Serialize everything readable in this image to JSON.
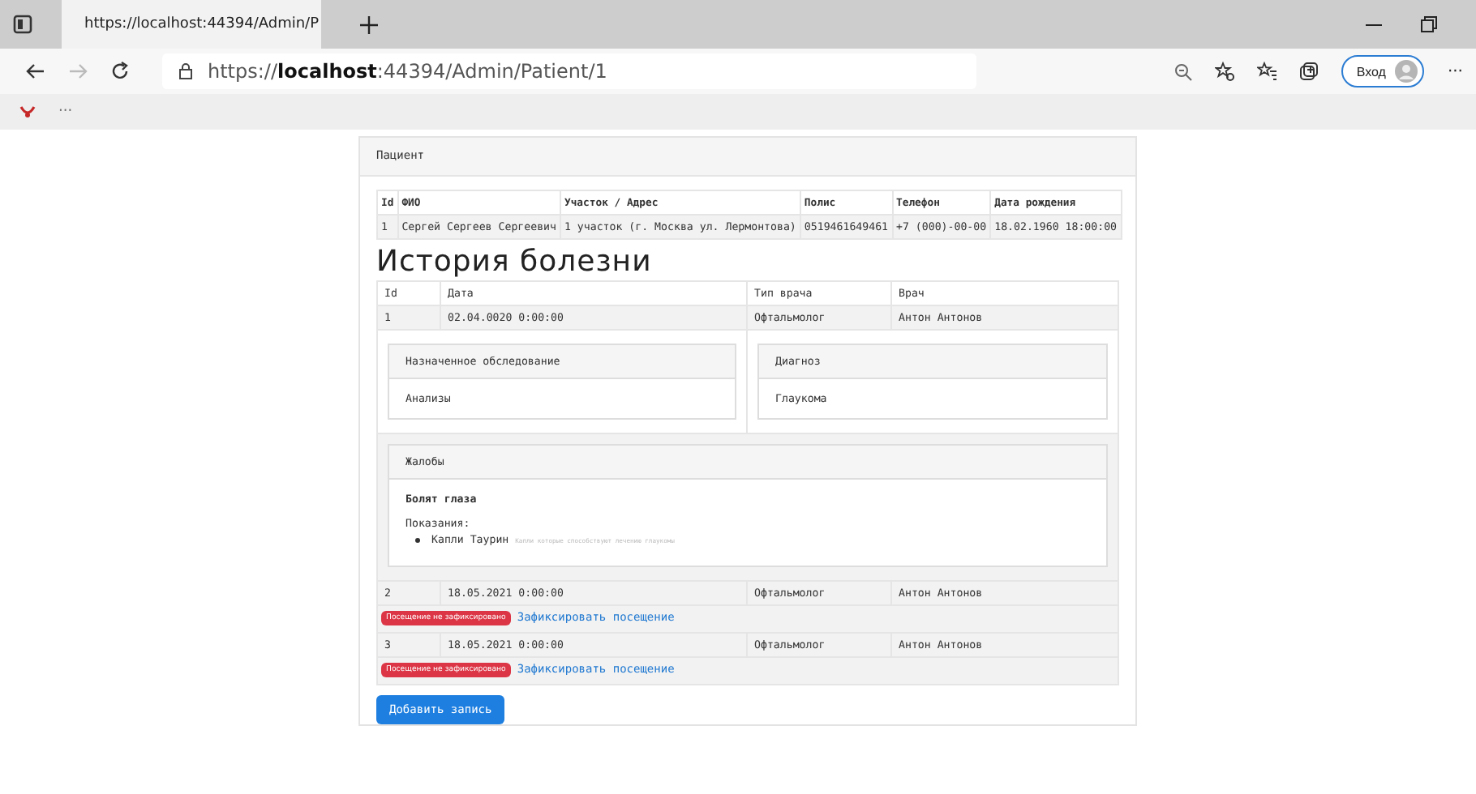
{
  "browser": {
    "tab_title": "https://localhost:44394/Admin/P",
    "url": "https://**localhost**:44394/Admin/Patient/1",
    "sign_in": "Вход",
    "more": "···",
    "bookmarks_more": "···"
  },
  "panel_title": "Пациент",
  "patient_table": {
    "columns": [
      "Id",
      "ФИО",
      "Участок / Адрес",
      "Полис",
      "Телефон",
      "Дата рождения"
    ],
    "rows": [
      [
        "1",
        "Сергей Сергеев Сергеевич",
        "1 участок (г. Москва ул. Лермонтова)",
        "0519461649461",
        "+7 (000)-00-00",
        "18.02.1960 18:00:00"
      ]
    ]
  },
  "history_title": "История болезни",
  "history_table": {
    "columns": [
      "Id",
      "Дата",
      "Тип врача",
      "Врач"
    ],
    "visits": [
      {
        "cells": [
          "1",
          "02.04.0020 0:00:00",
          "Офтальмолог",
          "Антон Антонов"
        ],
        "details": {
          "exam_title": "Назначенное обследование",
          "exam": "Анализы",
          "diagnosis_title": "Диагноз",
          "diagnosis": "Глаукома",
          "complaints_title": "Жалобы",
          "complaints": "Болят глаза",
          "indications_label": "Показания:",
          "medications": [
            {
              "name": "Капли Таурин",
              "note": "Капли которые способствуют лечению глаукомы"
            }
          ]
        }
      },
      {
        "cells": [
          "2",
          "18.05.2021 0:00:00",
          "Офтальмолог",
          "Антон Антонов"
        ],
        "badge": "Посещение не зафиксировано",
        "link": "Зафиксировать посещение"
      },
      {
        "cells": [
          "3",
          "18.05.2021 0:00:00",
          "Офтальмолог",
          "Антон Антонов"
        ],
        "badge": "Посещение не зафиксировано",
        "link": "Зафиксировать посещение"
      }
    ]
  },
  "add_button": "Добавить запись"
}
